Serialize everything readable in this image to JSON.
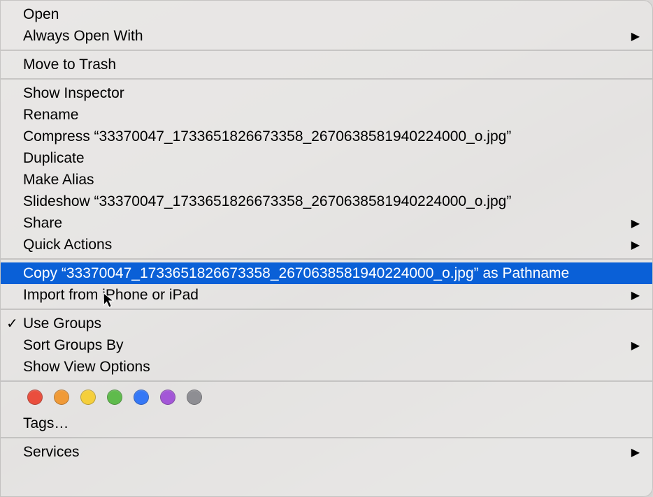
{
  "filename": "33370047_1733651826673358_2670638581940224000_o.jpg",
  "menu": {
    "open": "Open",
    "always_open_with": "Always Open With",
    "move_to_trash": "Move to Trash",
    "show_inspector": "Show Inspector",
    "rename": "Rename",
    "compress": "Compress “33370047_1733651826673358_2670638581940224000_o.jpg”",
    "duplicate": "Duplicate",
    "make_alias": "Make Alias",
    "slideshow": "Slideshow “33370047_1733651826673358_2670638581940224000_o.jpg”",
    "share": "Share",
    "quick_actions": "Quick Actions",
    "copy_pathname": "Copy “33370047_1733651826673358_2670638581940224000_o.jpg” as Pathname",
    "import": "Import from iPhone or iPad",
    "use_groups": "Use Groups",
    "sort_groups_by": "Sort Groups By",
    "show_view_options": "Show View Options",
    "tags": "Tags…",
    "services": "Services"
  },
  "state": {
    "highlighted": "copy_pathname",
    "checked": "use_groups"
  },
  "tag_colors": [
    "#ea4e3d",
    "#f09a37",
    "#f5cf3c",
    "#5fbb4c",
    "#3578f6",
    "#a357d7",
    "#8e8e93"
  ]
}
